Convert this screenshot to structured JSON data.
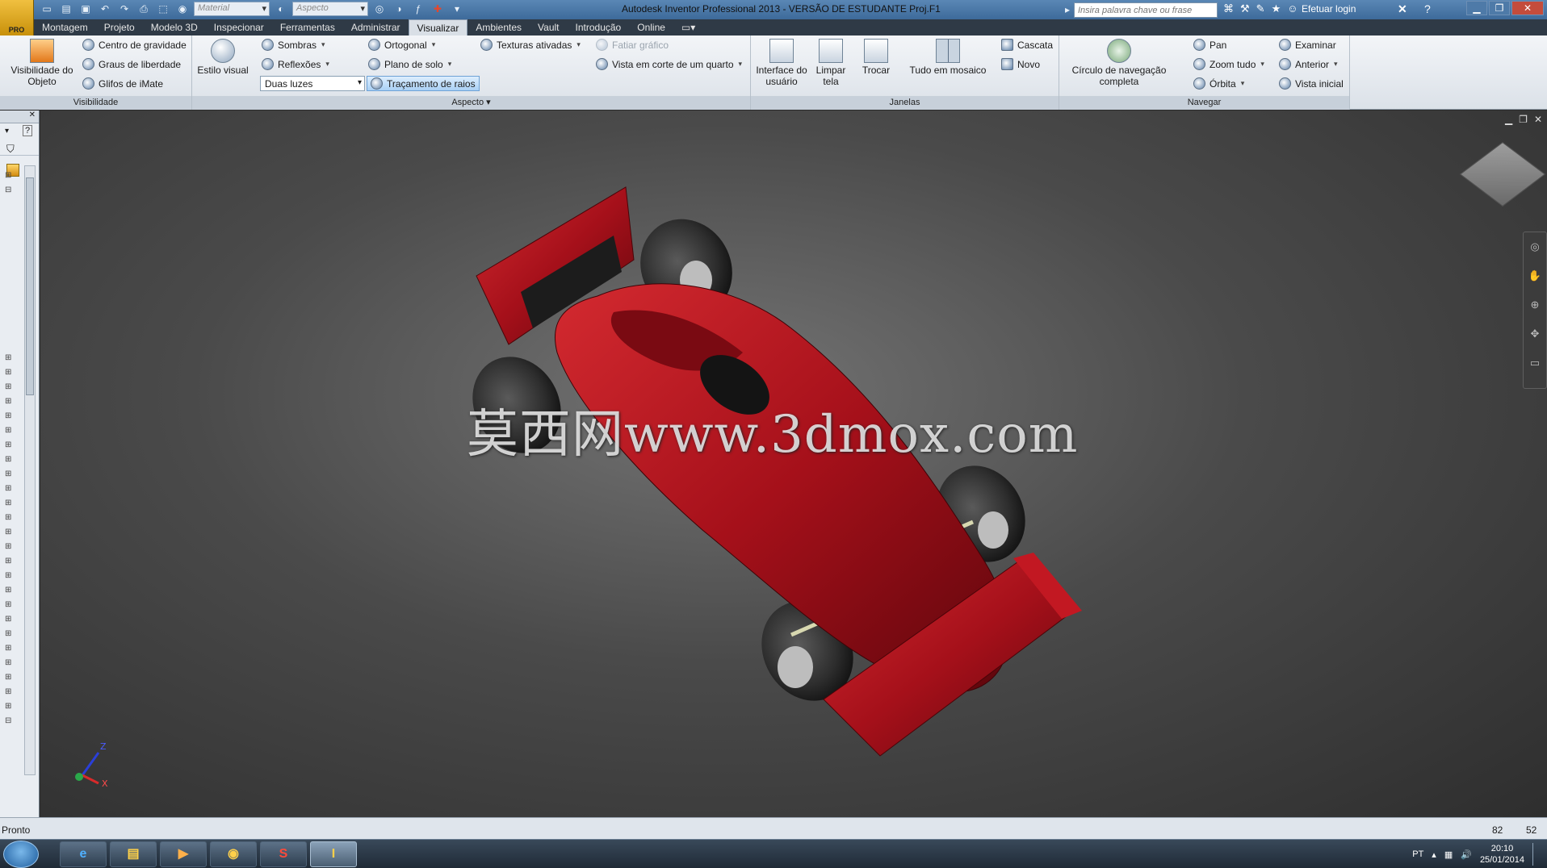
{
  "app": {
    "badge": "PRO",
    "title": "Autodesk Inventor Professional 2013 - VERSÃO DE ESTUDANTE    Proj.F1"
  },
  "qat": {
    "material_label": "Material",
    "appearance_label": "Aspecto"
  },
  "search": {
    "placeholder": "Insira palavra chave ou frase"
  },
  "login": {
    "label": "Efetuar login"
  },
  "tabs": [
    "Montagem",
    "Projeto",
    "Modelo 3D",
    "Inspecionar",
    "Ferramentas",
    "Administrar",
    "Visualizar",
    "Ambientes",
    "Vault",
    "Introdução",
    "Online"
  ],
  "tabs_active": "Visualizar",
  "ribbon": {
    "visibilidade": {
      "title": "Visibilidade",
      "big": "Visibilidade do Objeto",
      "items": [
        "Centro de gravidade",
        "Graus de liberdade",
        "Glifos de iMate"
      ]
    },
    "aspecto": {
      "title": "Aspecto",
      "big": "Estilo visual",
      "items": [
        "Sombras",
        "Reflexões",
        "Ortogonal",
        "Plano de solo",
        "Traçamento de raios",
        "Texturas ativadas",
        "Fatiar gráfico",
        "Vista em corte de um quarto"
      ],
      "lighting": "Duas luzes"
    },
    "janelas": {
      "title": "Janelas",
      "big": [
        "Interface do usuário",
        "Limpar tela",
        "Trocar",
        "Tudo em mosaico"
      ],
      "items": [
        "Cascata",
        "Novo"
      ]
    },
    "navegar": {
      "title": "Navegar",
      "big": "Círculo de navegação completa",
      "items": [
        "Pan",
        "Zoom tudo",
        "Órbita",
        "Examinar",
        "Anterior",
        "Vista inicial"
      ]
    }
  },
  "viewport": {
    "watermark": "莫西网www.3dmox.com",
    "triad": {
      "z": "Z",
      "x": "X"
    }
  },
  "status": {
    "text": "Pronto",
    "n1": "82",
    "n2": "52"
  },
  "taskbar": {
    "lang": "PT",
    "time": "20:10",
    "date": "25/01/2014"
  },
  "colors": {
    "car": "#b0121b",
    "titlebar": "#3d6a9a",
    "ribbon": "#e6ebf0"
  }
}
